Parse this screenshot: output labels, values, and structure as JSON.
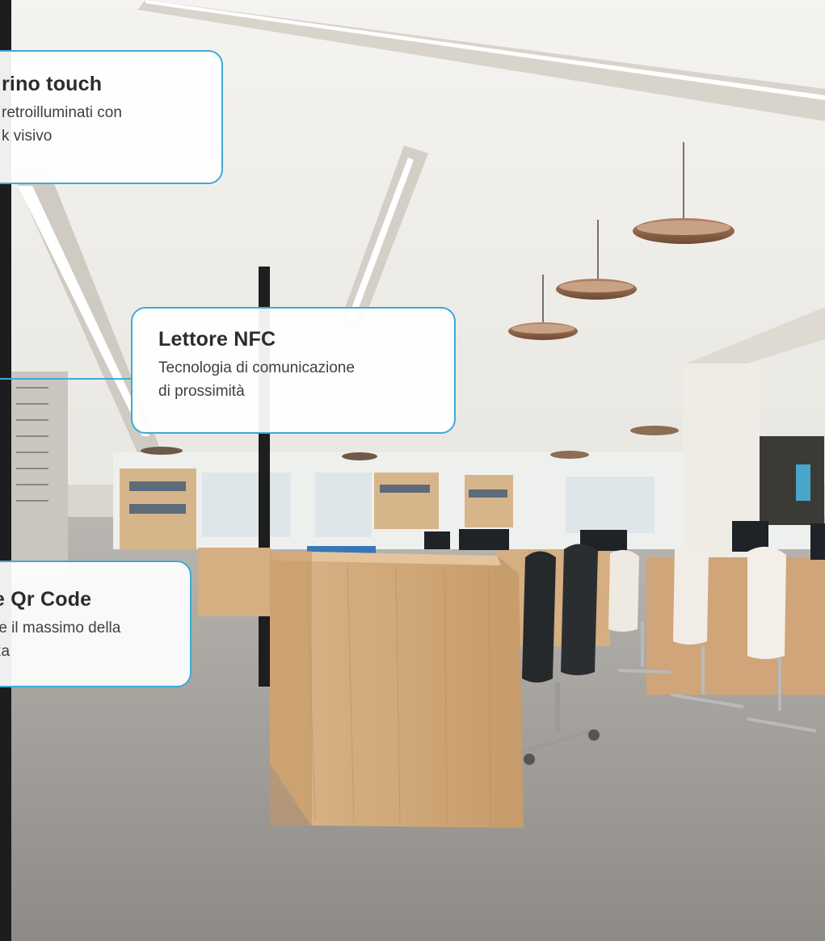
{
  "callouts": [
    {
      "title": "rino touch",
      "text": "retroilluminati con\nk visivo"
    },
    {
      "title": "Lettore NFC",
      "text": "Tecnologia di comunicazione\ndi prossimità"
    },
    {
      "title": "e Qr Code",
      "text": "re il massimo della\nza"
    }
  ],
  "colors": {
    "accent": "#3fa9d9"
  }
}
